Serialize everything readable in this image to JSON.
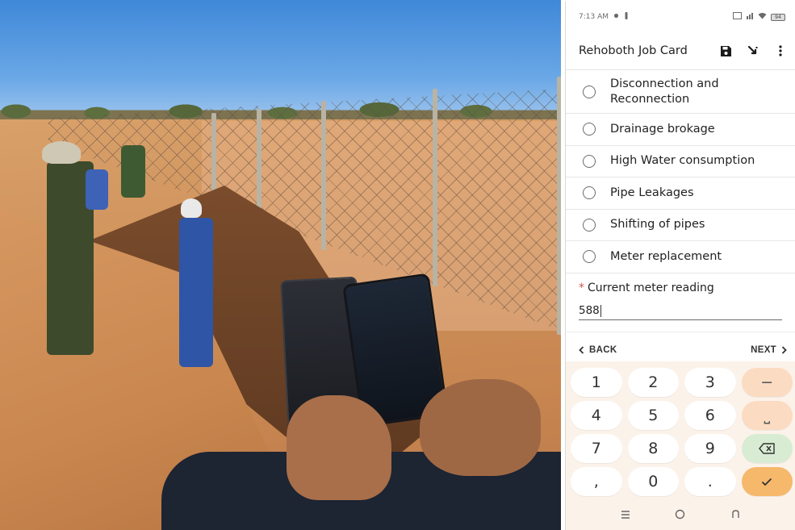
{
  "status_bar": {
    "time": "7:13 AM",
    "battery": "94"
  },
  "app_bar": {
    "title": "Rehoboth Job Card",
    "actions": [
      "save-icon",
      "jump-icon",
      "more-vert-icon"
    ]
  },
  "options": [
    {
      "label": "Disconnection and Reconnection"
    },
    {
      "label": "Drainage brokage"
    },
    {
      "label": "High Water consumption"
    },
    {
      "label": "Pipe Leakages"
    },
    {
      "label": "Shifting of pipes"
    },
    {
      "label": "Meter replacement"
    }
  ],
  "question": {
    "required_mark": "*",
    "label": "Current meter reading",
    "value": "588"
  },
  "navigation": {
    "back_label": "BACK",
    "next_label": "NEXT"
  },
  "keyboard": {
    "rows": [
      [
        "1",
        "2",
        "3",
        "−"
      ],
      [
        "4",
        "5",
        "6",
        "⎵"
      ],
      [
        "7",
        "8",
        "9",
        "⌫"
      ],
      [
        ",",
        "0",
        ".",
        "✓"
      ]
    ]
  },
  "colors": {
    "keyboard_bg": "#fbf2ea",
    "fn_key": "#fbdcc2",
    "delete_key": "#d8ecd3",
    "ok_key": "#f6b86a",
    "required_star": "#d9534f"
  }
}
